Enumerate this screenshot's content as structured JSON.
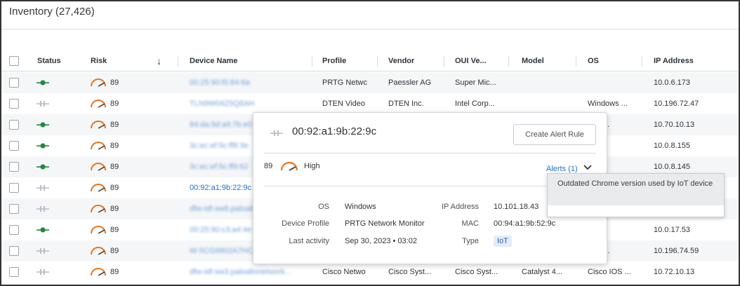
{
  "page": {
    "title": "Inventory (27,426)"
  },
  "table": {
    "columns": [
      "Status",
      "Risk",
      "Device Name",
      "Profile",
      "Vendor",
      "OUI Ve...",
      "Model",
      "OS",
      "IP Address"
    ],
    "rows": [
      {
        "status": "online",
        "risk": "89",
        "name": "00:25:90:f0:84:6a",
        "name_style": "blurred",
        "profile": "PRTG Netwc",
        "vendor": "Paessler AG",
        "oui": "Super Mic...",
        "model": "",
        "os": "",
        "ip": "10.0.6.173"
      },
      {
        "status": "offline",
        "risk": "89",
        "name": "TLN9W04Z5Q8AH",
        "name_style": "blurred",
        "profile": "DTEN Video",
        "vendor": "DTEN Inc.",
        "oui": "Intel Corp...",
        "model": "",
        "os": "Windows ...",
        "ip": "10.196.72.47"
      },
      {
        "status": "online",
        "risk": "89",
        "name": "84:da:9d:a9:7b:e0",
        "name_style": "blurred",
        "profile": "",
        "vendor": "",
        "oui": "",
        "model": "",
        "os": "IOS ...",
        "ip": "10.70.10.13"
      },
      {
        "status": "online",
        "risk": "89",
        "name": "3c:ec:ef:5c:ff8:3e",
        "name_style": "blurred",
        "profile": "",
        "vendor": "",
        "oui": "",
        "model": "",
        "os": "",
        "ip": "10.0.8.155"
      },
      {
        "status": "online",
        "risk": "89",
        "name": "3c:ec:ef:5c:ff9:62",
        "name_style": "blurred",
        "profile": "",
        "vendor": "",
        "oui": "",
        "model": "",
        "os": "",
        "ip": "10.0.8.145"
      },
      {
        "status": "offline",
        "risk": "89",
        "name": "00:92:a1:9b:22:9c",
        "name_style": "link",
        "profile": "",
        "vendor": "",
        "oui": "",
        "model": "",
        "os": "",
        "ip": ""
      },
      {
        "status": "offline",
        "risk": "89",
        "name": "dfw-idf-sw8.paloalt",
        "name_style": "blurred",
        "profile": "",
        "vendor": "",
        "oui": "",
        "model": "",
        "os": "",
        "ip": ""
      },
      {
        "status": "online",
        "risk": "89",
        "name": "00:25:90:c3:a4:4e",
        "name_style": "blurred",
        "profile": "",
        "vendor": "",
        "oui": "",
        "model": "",
        "os": "",
        "ip": "10.0.17.53"
      },
      {
        "status": "offline",
        "risk": "89",
        "name": "W-5CG9902A7HC",
        "name_style": "blurred",
        "profile": "",
        "vendor": "",
        "oui": "",
        "model": "",
        "os": "ows ...",
        "ip": "10.196.74.59"
      },
      {
        "status": "offline",
        "risk": "89",
        "name": "dfw-idf-sw3.paloaltonetwork...",
        "name_style": "blurred",
        "profile": "Cisco Netwo",
        "vendor": "Cisco Syst...",
        "oui": "Cisco Syst...",
        "model": "Catalyst 4...",
        "os": "Cisco IOS ...",
        "ip": "10.72.10.13"
      }
    ]
  },
  "popover": {
    "device_name": "00:92:a1:9b:22:9c",
    "create_button": "Create Alert Rule",
    "risk_value": "89",
    "risk_level": "High",
    "alerts_link": "Alerts (1)",
    "details": {
      "os_label": "OS",
      "os_value": "Windows",
      "profile_label": "Device Profile",
      "profile_value": "PRTG Network Monitor",
      "activity_label": "Last activity",
      "activity_value": "Sep 30, 2023 • 03:02",
      "ip_label": "IP Address",
      "ip_value": "10.101.18.43",
      "mac_label": "MAC",
      "mac_value": "00:94:a1:9b:52:9c",
      "type_label": "Type",
      "type_value": "IoT"
    }
  },
  "alerts_dropdown": {
    "items": [
      "Outdated Chrome version used by IoT device"
    ]
  },
  "colors": {
    "online": "#1e8a3c",
    "offline": "#b8bec4",
    "risk_orange": "#e8731a",
    "link": "#1a73c8"
  },
  "icons": {
    "status_online": "network-plug-icon",
    "status_offline": "network-plug-icon",
    "risk": "risk-gauge-icon",
    "sort": "arrow-down-icon",
    "chevron": "chevron-down-icon"
  }
}
